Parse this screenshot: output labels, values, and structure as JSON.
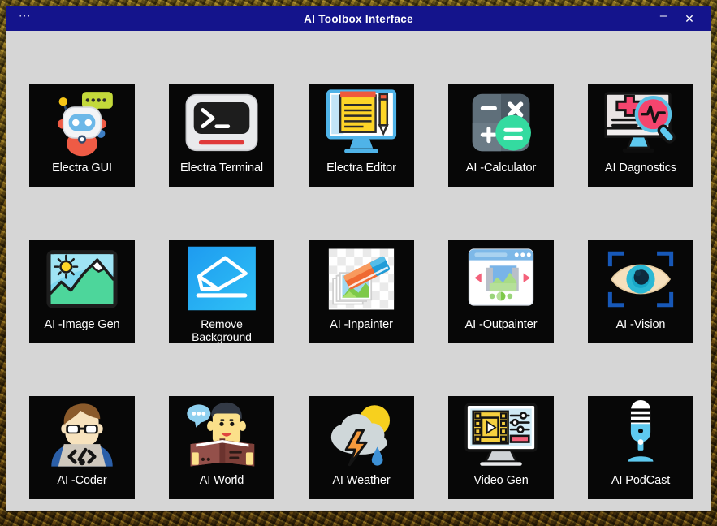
{
  "window": {
    "title": "AI Toolbox Interface",
    "menu_icon": "ellipsis-icon",
    "minimize_label": "–",
    "close_label": "✕",
    "titlebar_color": "#14148c",
    "body_color": "#d6d6d6",
    "tile_color": "#070707"
  },
  "grid": {
    "columns": 5,
    "rows": 3,
    "tiles": [
      {
        "id": "electra-gui",
        "label": "Electra GUI",
        "icon": "robot-chat-icon",
        "two_line": false
      },
      {
        "id": "electra-terminal",
        "label": "Electra Terminal",
        "icon": "terminal-prompt-icon",
        "two_line": false
      },
      {
        "id": "electra-editor",
        "label": "Electra Editor",
        "icon": "notepad-pencil-monitor-icon",
        "two_line": false
      },
      {
        "id": "ai-calculator",
        "label": "AI -Calculator",
        "icon": "calculator-icon",
        "two_line": false
      },
      {
        "id": "ai-dagnostics",
        "label": "AI Dagnostics",
        "icon": "medical-monitor-magnifier-icon",
        "two_line": false
      },
      {
        "id": "ai-image-gen",
        "label": "AI -Image Gen",
        "icon": "landscape-photo-icon",
        "two_line": false
      },
      {
        "id": "remove-background",
        "label": "Remove\nBackground",
        "icon": "eraser-blue-icon",
        "two_line": true
      },
      {
        "id": "ai-inpainter",
        "label": "AI -Inpainter",
        "icon": "eraser-photos-icon",
        "two_line": false
      },
      {
        "id": "ai-outpainter",
        "label": "AI -Outpainter",
        "icon": "expand-canvas-window-icon",
        "two_line": false
      },
      {
        "id": "ai-vision",
        "label": "AI -Vision",
        "icon": "eye-scan-icon",
        "two_line": false
      },
      {
        "id": "ai-coder",
        "label": "AI -Coder",
        "icon": "coder-laptop-icon",
        "two_line": false
      },
      {
        "id": "ai-world",
        "label": "AI World",
        "icon": "reader-book-chat-icon",
        "two_line": false
      },
      {
        "id": "ai-weather",
        "label": "AI Weather",
        "icon": "cloud-sun-storm-icon",
        "two_line": false
      },
      {
        "id": "video-gen",
        "label": "Video Gen",
        "icon": "video-editor-monitor-icon",
        "two_line": false
      },
      {
        "id": "ai-podcast",
        "label": "AI PodCast",
        "icon": "microphone-icon",
        "two_line": false
      }
    ]
  }
}
